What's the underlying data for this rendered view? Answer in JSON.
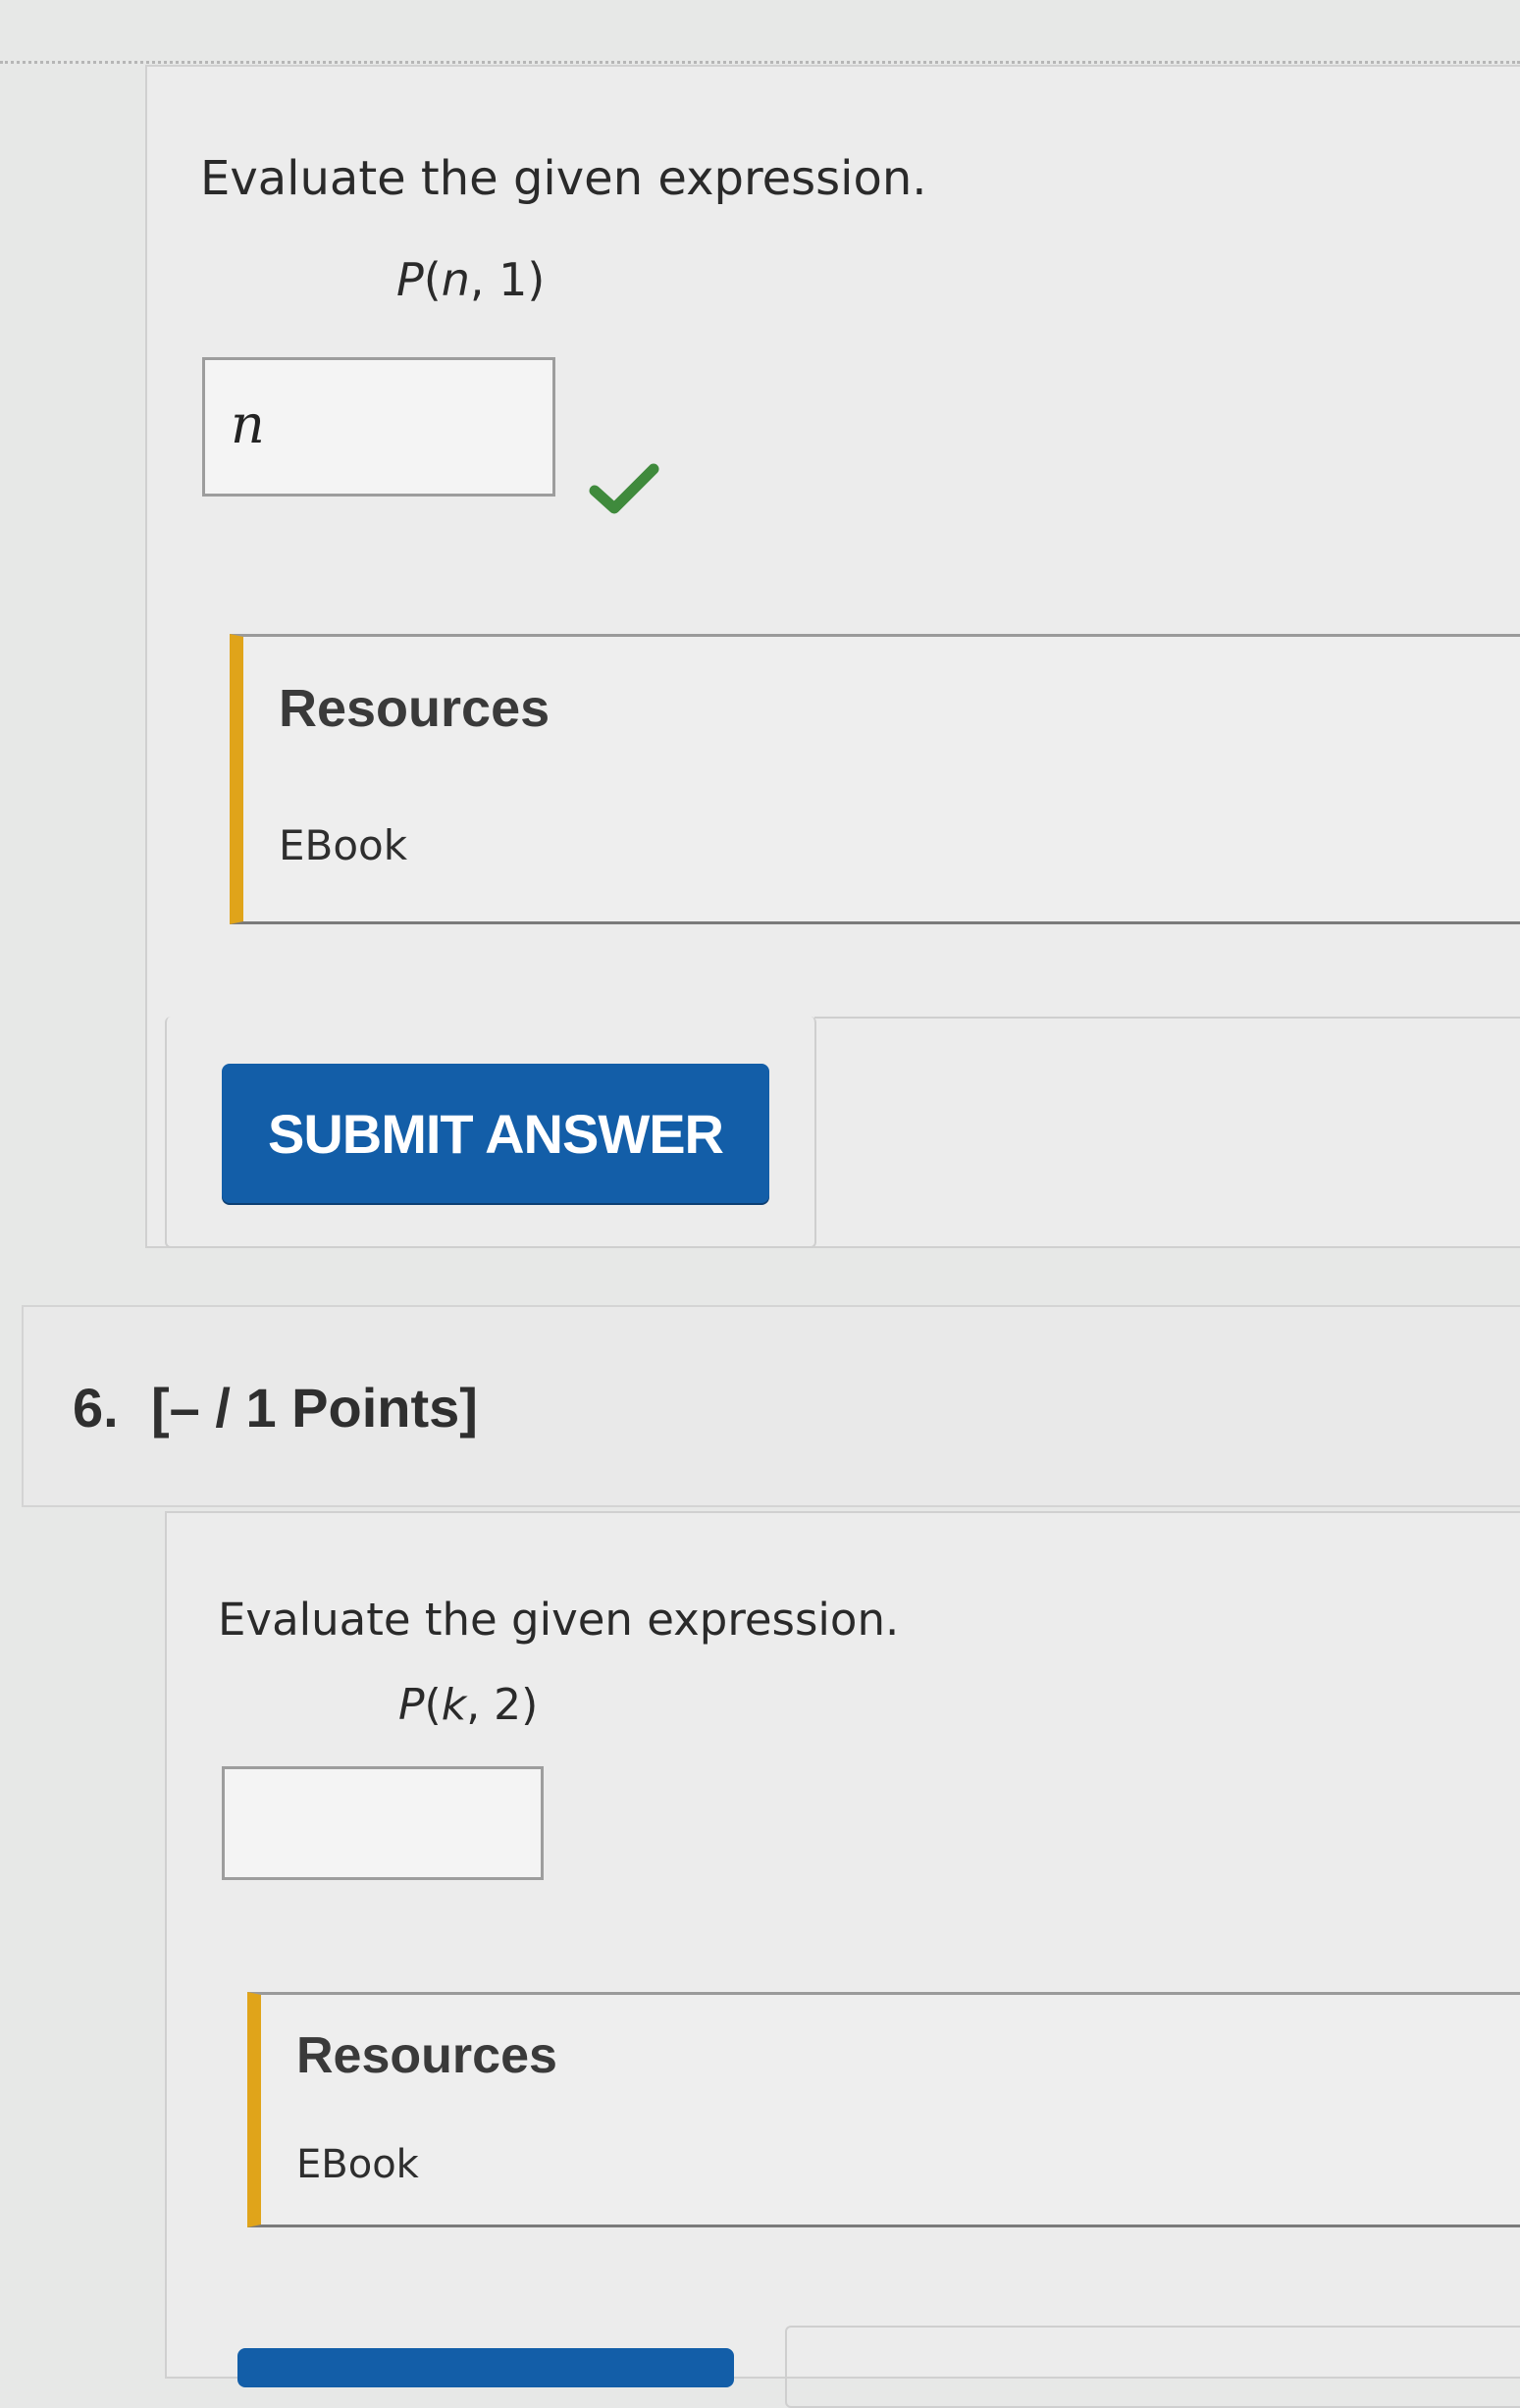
{
  "question_5": {
    "prompt": "Evaluate the given expression.",
    "expression": {
      "fn": "P",
      "open": "(",
      "var": "n",
      "rest": ", 1)"
    },
    "answer_value": "n",
    "status": "correct",
    "resources": {
      "title": "Resources",
      "link": "EBook"
    },
    "submit_label": "SUBMIT ANSWER"
  },
  "question_6": {
    "number": "6.",
    "points": "[– / 1 Points]",
    "prompt": "Evaluate the given expression.",
    "expression": {
      "fn": "P",
      "open": "(",
      "var": "k",
      "rest": ", 2)"
    },
    "answer_value": "",
    "resources": {
      "title": "Resources",
      "link": "EBook"
    }
  },
  "colors": {
    "submit_button": "#135ea8",
    "resources_accent": "#e0a41a",
    "check_mark": "#3f8a3c"
  },
  "icons": {
    "check": "check-icon"
  }
}
